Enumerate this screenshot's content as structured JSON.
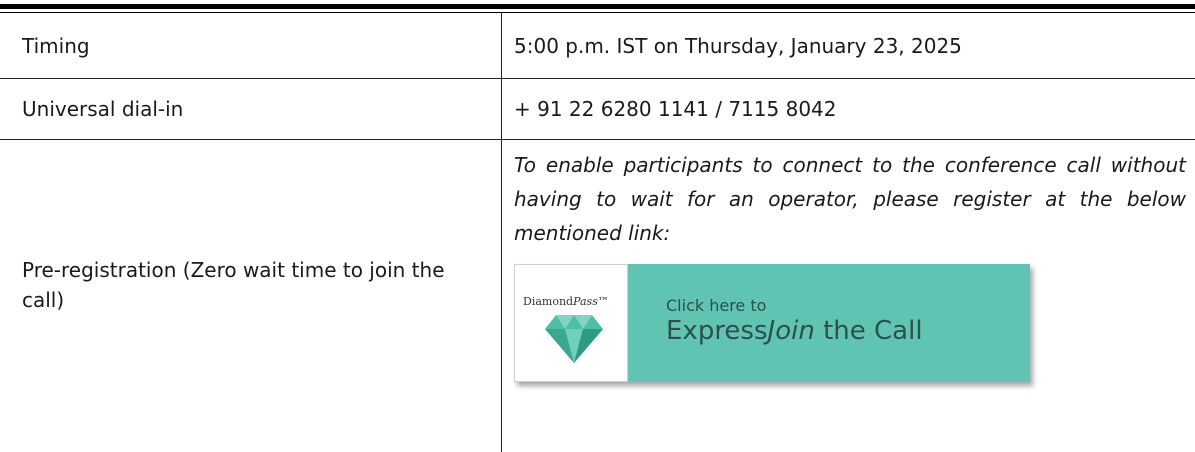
{
  "rows": [
    {
      "label": "Timing",
      "value": "5:00 p.m. IST on Thursday, January 23, 2025"
    },
    {
      "label": "Universal dial-in",
      "value": "+ 91 22 6280 1141 / 7115 8042"
    },
    {
      "label": "Pre-registration (Zero wait time to join the call)",
      "value": "To enable participants to connect to the conference call without having to wait for an operator, please register at the below mentioned link:"
    }
  ],
  "banner": {
    "brand_main": "Diamond",
    "brand_italic": "Pass",
    "brand_tm": "™",
    "cta_line1": "Click here to",
    "cta_word1": "Express",
    "cta_word2": "Join",
    "cta_word3": " the Call",
    "accent_color": "#5fc4b2",
    "icon": "diamond-icon"
  }
}
